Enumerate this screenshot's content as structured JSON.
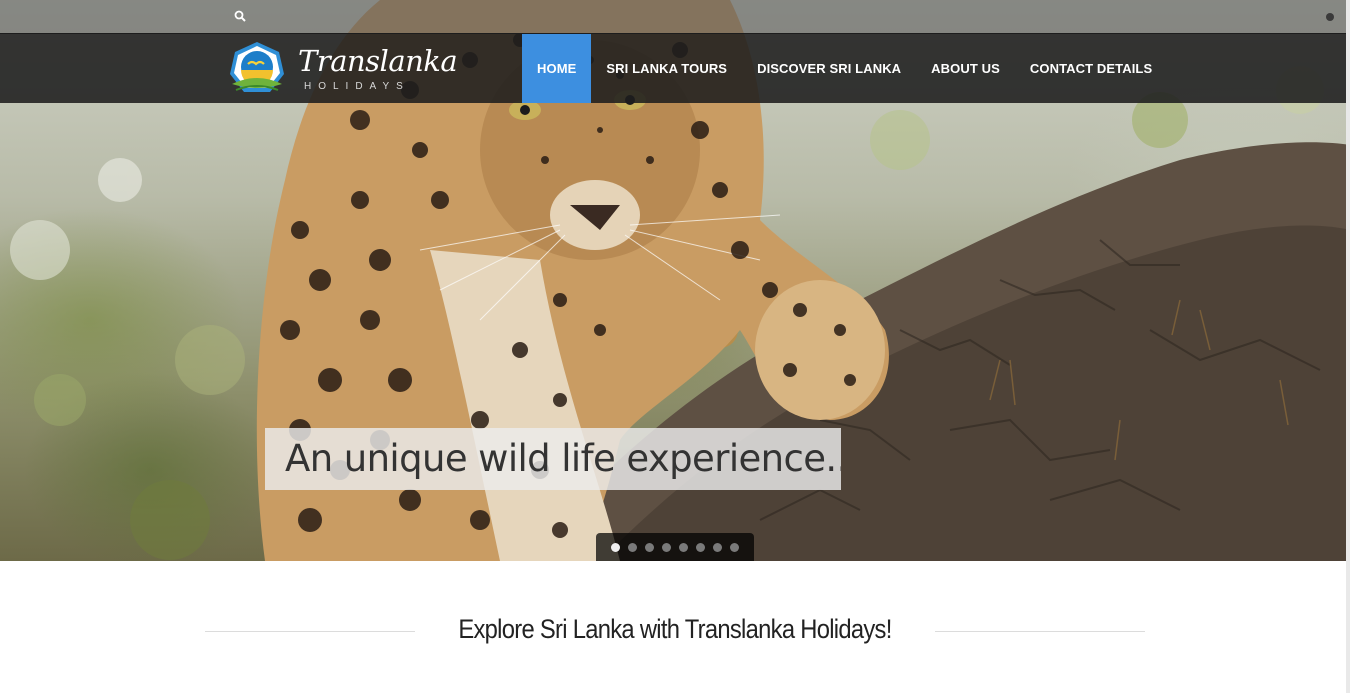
{
  "topbar": {
    "search_icon": "search-icon"
  },
  "header": {
    "logo": {
      "name": "Translanka",
      "subtitle": "HOLIDAYS",
      "icon": "bird-sun-icon"
    },
    "nav": [
      {
        "label": "HOME",
        "active": true
      },
      {
        "label": "SRI LANKA TOURS",
        "active": false
      },
      {
        "label": "DISCOVER SRI LANKA",
        "active": false
      },
      {
        "label": "ABOUT US",
        "active": false
      },
      {
        "label": "CONTACT DETAILS",
        "active": false
      }
    ]
  },
  "slider": {
    "caption": "An unique wild life experience...",
    "slide_count": 8,
    "active_index": 0,
    "image": "leopard-on-tree"
  },
  "main": {
    "heading": "Explore Sri Lanka with Translanka Holidays!"
  },
  "colors": {
    "accent": "#3d8fe0",
    "header_bg": "#1e1e1e",
    "heading": "#222222"
  }
}
